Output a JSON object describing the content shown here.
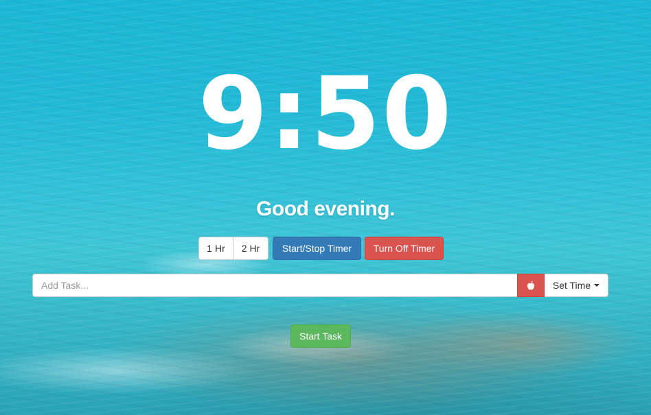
{
  "clock": {
    "time": "9:50"
  },
  "greeting": "Good evening.",
  "timer_controls": {
    "one_hour_label": "1 Hr",
    "two_hour_label": "2 Hr",
    "start_stop_label": "Start/Stop Timer",
    "turn_off_label": "Turn Off Timer"
  },
  "task": {
    "input_value": "",
    "input_placeholder": "Add Task...",
    "pomodoro_icon": "apple-icon",
    "set_time_label": "Set Time",
    "start_label": "Start Task"
  },
  "colors": {
    "primary": "#337ab7",
    "danger": "#d9534f",
    "success": "#5cb85c"
  }
}
